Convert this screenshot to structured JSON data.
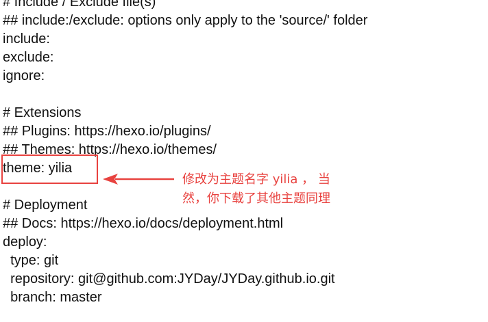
{
  "config_lines": [
    "# Include / Exclude file(s)",
    "## include:/exclude: options only apply to the 'source/' folder",
    "include:",
    "exclude:",
    "ignore:",
    "",
    "# Extensions",
    "## Plugins: https://hexo.io/plugins/",
    "## Themes: https://hexo.io/themes/",
    "theme: yilia",
    "",
    "# Deployment",
    "## Docs: https://hexo.io/docs/deployment.html",
    "deploy:",
    "  type: git",
    "  repository: git@github.com:JYDay/JYDay.github.io.git",
    "  branch: master"
  ],
  "annotation": {
    "text": "修改为主题名字 yilia ， 当然，你下载了其他主题同理",
    "color": "#e8423f"
  }
}
